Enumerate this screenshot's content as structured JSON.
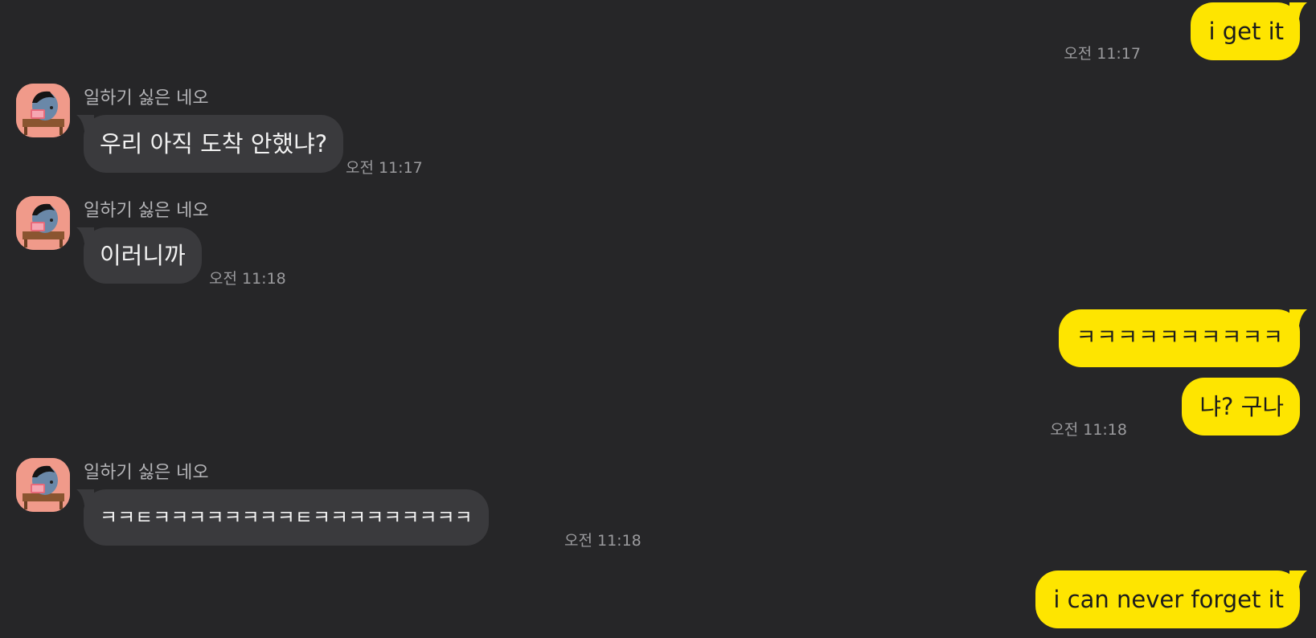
{
  "messages": [
    {
      "sender": "me",
      "text": "i get it",
      "time": "오전 11:17"
    },
    {
      "sender": "other",
      "name": "일하기 싫은 네오",
      "text": "우리 아직 도착 안했냐?",
      "time": "오전 11:17"
    },
    {
      "sender": "other",
      "name": "일하기 싫은 네오",
      "text": "이러니까",
      "time": "오전 11:18"
    },
    {
      "sender": "me",
      "text": "ㅋㅋㅋㅋㅋㅋㅋㅋㅋㅋ",
      "time": ""
    },
    {
      "sender": "me",
      "text": "냐? 구나",
      "time": "오전 11:18"
    },
    {
      "sender": "other",
      "name": "일하기 싫은 네오",
      "text": "ㅋㅋㅌㅋㅋㅋㅋㅋㅋㅋㅋㅌㅋㅋㅋㅋㅋㅋㅋㅋㅋ",
      "time": "오전 11:18"
    },
    {
      "sender": "me",
      "text": "i can never forget it",
      "time": ""
    }
  ],
  "colors": {
    "background": "#262628",
    "my_bubble": "#fee500",
    "their_bubble": "#3a3a3d",
    "avatar_bg": "#f09a8a"
  },
  "icons": {
    "avatar": "neo-character-avatar"
  }
}
